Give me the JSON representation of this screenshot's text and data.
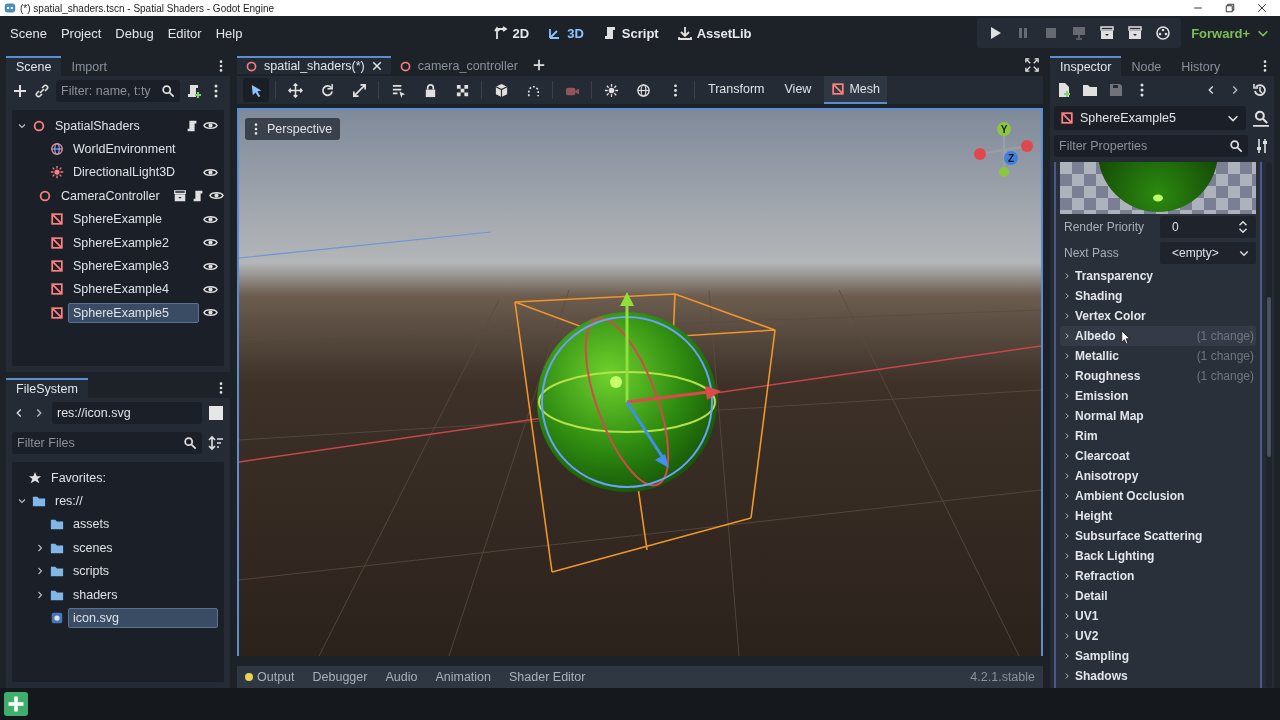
{
  "window": {
    "title": "(*) spatial_shaders.tscn - Spatial Shaders - Godot Engine"
  },
  "menu": [
    "Scene",
    "Project",
    "Debug",
    "Editor",
    "Help"
  ],
  "workspaces": [
    {
      "kind": "twod",
      "label": "2D",
      "selected": false
    },
    {
      "kind": "threed",
      "label": "3D",
      "selected": true
    },
    {
      "kind": "script",
      "label": "Script",
      "selected": false
    },
    {
      "kind": "download",
      "label": "AssetLib",
      "selected": false
    }
  ],
  "run_controls": [
    {
      "kind": "play",
      "disabled": false
    },
    {
      "kind": "pause",
      "disabled": true
    },
    {
      "kind": "stop",
      "disabled": true
    },
    {
      "kind": "monitor",
      "disabled": true
    },
    {
      "kind": "clapper",
      "disabled": false
    },
    {
      "kind": "clapper",
      "disabled": false
    },
    {
      "kind": "reel",
      "disabled": false
    }
  ],
  "renderer": "Forward+",
  "scene_dock": {
    "tabs": [
      {
        "label": "Scene",
        "selected": true
      },
      {
        "label": "Import",
        "selected": false
      }
    ],
    "filter": {
      "placeholder": "Filter: name, t:ty"
    },
    "tree": [
      {
        "name": "SpatialShaders",
        "kind": "node",
        "expanded": true,
        "selected": false,
        "badges": [
          {
            "kind": "script"
          }
        ],
        "visible": true,
        "children": [
          {
            "name": "WorldEnvironment",
            "kind": "globe",
            "selected": false
          },
          {
            "name": "DirectionalLight3D",
            "kind": "light",
            "selected": false,
            "visible": true
          },
          {
            "name": "CameraController",
            "kind": "node",
            "selected": false,
            "badges": [
              {
                "kind": "clapper"
              },
              {
                "kind": "script"
              }
            ],
            "visible": true
          },
          {
            "name": "SphereExample",
            "kind": "mesh",
            "selected": false,
            "visible": true
          },
          {
            "name": "SphereExample2",
            "kind": "mesh",
            "selected": false,
            "visible": true
          },
          {
            "name": "SphereExample3",
            "kind": "mesh",
            "selected": false,
            "visible": true
          },
          {
            "name": "SphereExample4",
            "kind": "mesh",
            "selected": false,
            "visible": true
          },
          {
            "name": "SphereExample5",
            "kind": "mesh",
            "selected": true,
            "visible": true
          }
        ]
      }
    ]
  },
  "filesystem": {
    "tabs": [
      {
        "label": "FileSystem",
        "selected": true
      }
    ],
    "path": "res://icon.svg",
    "filter": {
      "placeholder": "Filter Files"
    },
    "favorites": "Favorites:",
    "tree": [
      {
        "name": "res://",
        "kind": "folder",
        "expanded": true,
        "selected": false,
        "children": [
          {
            "name": "assets",
            "kind": "folder",
            "selected": false
          },
          {
            "name": "scenes",
            "kind": "folder",
            "expanded": false,
            "selected": false
          },
          {
            "name": "scripts",
            "kind": "folder",
            "expanded": false,
            "selected": false
          },
          {
            "name": "shaders",
            "kind": "folder",
            "expanded": false,
            "selected": false
          },
          {
            "name": "icon.svg",
            "kind": "image",
            "selected": true
          }
        ]
      }
    ]
  },
  "editor_tabs": [
    {
      "label": "spatial_shaders(*)",
      "selected": true,
      "closable": true
    },
    {
      "label": "camera_controller",
      "selected": false,
      "closable": false
    }
  ],
  "viewport_toolbar": {
    "tools": [
      {
        "kind": "pointer",
        "selected": true,
        "disabled": false
      },
      {
        "kind": "move",
        "selected": false,
        "disabled": false
      },
      {
        "kind": "rotate",
        "selected": false,
        "disabled": false
      },
      {
        "kind": "scale",
        "selected": false,
        "disabled": false
      },
      {
        "kind": "list",
        "selected": false,
        "disabled": false
      },
      {
        "kind": "lock",
        "selected": false,
        "disabled": false
      },
      {
        "kind": "grid",
        "selected": false,
        "disabled": false
      },
      {
        "kind": "cube",
        "selected": false,
        "disabled": false
      },
      {
        "kind": "snap",
        "selected": false,
        "disabled": false
      },
      {
        "kind": "camera",
        "selected": false,
        "disabled": true
      },
      {
        "kind": "sun",
        "selected": false,
        "disabled": false
      },
      {
        "kind": "globe",
        "selected": false,
        "disabled": false
      },
      {
        "kind": "more",
        "selected": false,
        "disabled": false
      }
    ],
    "menus": [
      {
        "label": "Transform",
        "selected": false
      },
      {
        "label": "View",
        "selected": false
      },
      {
        "label": "Mesh",
        "selected": true
      }
    ]
  },
  "viewport": {
    "view_menu": "Perspective",
    "axes": [
      "Y",
      "Z"
    ]
  },
  "bottom_tabs": [
    {
      "label": "Output",
      "notice": true
    },
    {
      "label": "Debugger",
      "notice": false
    },
    {
      "label": "Audio",
      "notice": false
    },
    {
      "label": "Animation",
      "notice": false
    },
    {
      "label": "Shader Editor",
      "notice": false
    }
  ],
  "version": "4.2.1.stable",
  "inspector": {
    "tabs": [
      {
        "label": "Inspector",
        "selected": true
      },
      {
        "label": "Node",
        "selected": false
      },
      {
        "label": "History",
        "selected": false
      }
    ],
    "toolbar": [
      {
        "kind": "newfile",
        "disabled": false
      },
      {
        "kind": "folder",
        "disabled": false
      },
      {
        "kind": "save",
        "disabled": true
      },
      {
        "kind": "more",
        "disabled": false
      }
    ],
    "object": "SphereExample5",
    "filter": {
      "placeholder": "Filter Properties"
    },
    "properties": [
      {
        "label": "Render Priority",
        "kind": "spin",
        "value": "0"
      },
      {
        "label": "Next Pass",
        "kind": "dropdown",
        "value": "<empty>"
      }
    ],
    "sections": [
      {
        "label": "Transparency",
        "highlighted": false
      },
      {
        "label": "Shading",
        "highlighted": false
      },
      {
        "label": "Vertex Color",
        "highlighted": false
      },
      {
        "label": "Albedo",
        "note": "(1 change)",
        "highlighted": true
      },
      {
        "label": "Metallic",
        "note": "(1 change)",
        "highlighted": false
      },
      {
        "label": "Roughness",
        "note": "(1 change)",
        "highlighted": false
      },
      {
        "label": "Emission",
        "highlighted": false
      },
      {
        "label": "Normal Map",
        "highlighted": false
      },
      {
        "label": "Rim",
        "highlighted": false
      },
      {
        "label": "Clearcoat",
        "highlighted": false
      },
      {
        "label": "Anisotropy",
        "highlighted": false
      },
      {
        "label": "Ambient Occlusion",
        "highlighted": false
      },
      {
        "label": "Height",
        "highlighted": false
      },
      {
        "label": "Subsurface Scattering",
        "highlighted": false
      },
      {
        "label": "Back Lighting",
        "highlighted": false
      },
      {
        "label": "Refraction",
        "highlighted": false
      },
      {
        "label": "Detail",
        "highlighted": false
      },
      {
        "label": "UV1",
        "highlighted": false
      },
      {
        "label": "UV2",
        "highlighted": false
      },
      {
        "label": "Sampling",
        "highlighted": false
      },
      {
        "label": "Shadows",
        "highlighted": false
      }
    ]
  }
}
